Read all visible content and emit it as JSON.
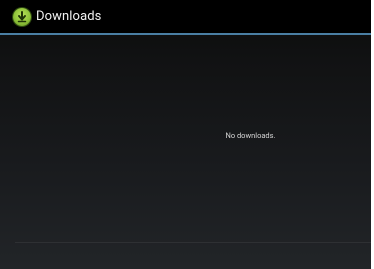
{
  "app": {
    "title": "Downloads",
    "icon": "download-app-icon"
  },
  "content": {
    "empty_message": "No downloads."
  },
  "colors": {
    "action_bar": "#000000",
    "action_bar_divider": "#4a7fa4",
    "icon_green": "#8fc23a",
    "background_top": "#0a0a0a",
    "background_bottom": "#222528"
  }
}
